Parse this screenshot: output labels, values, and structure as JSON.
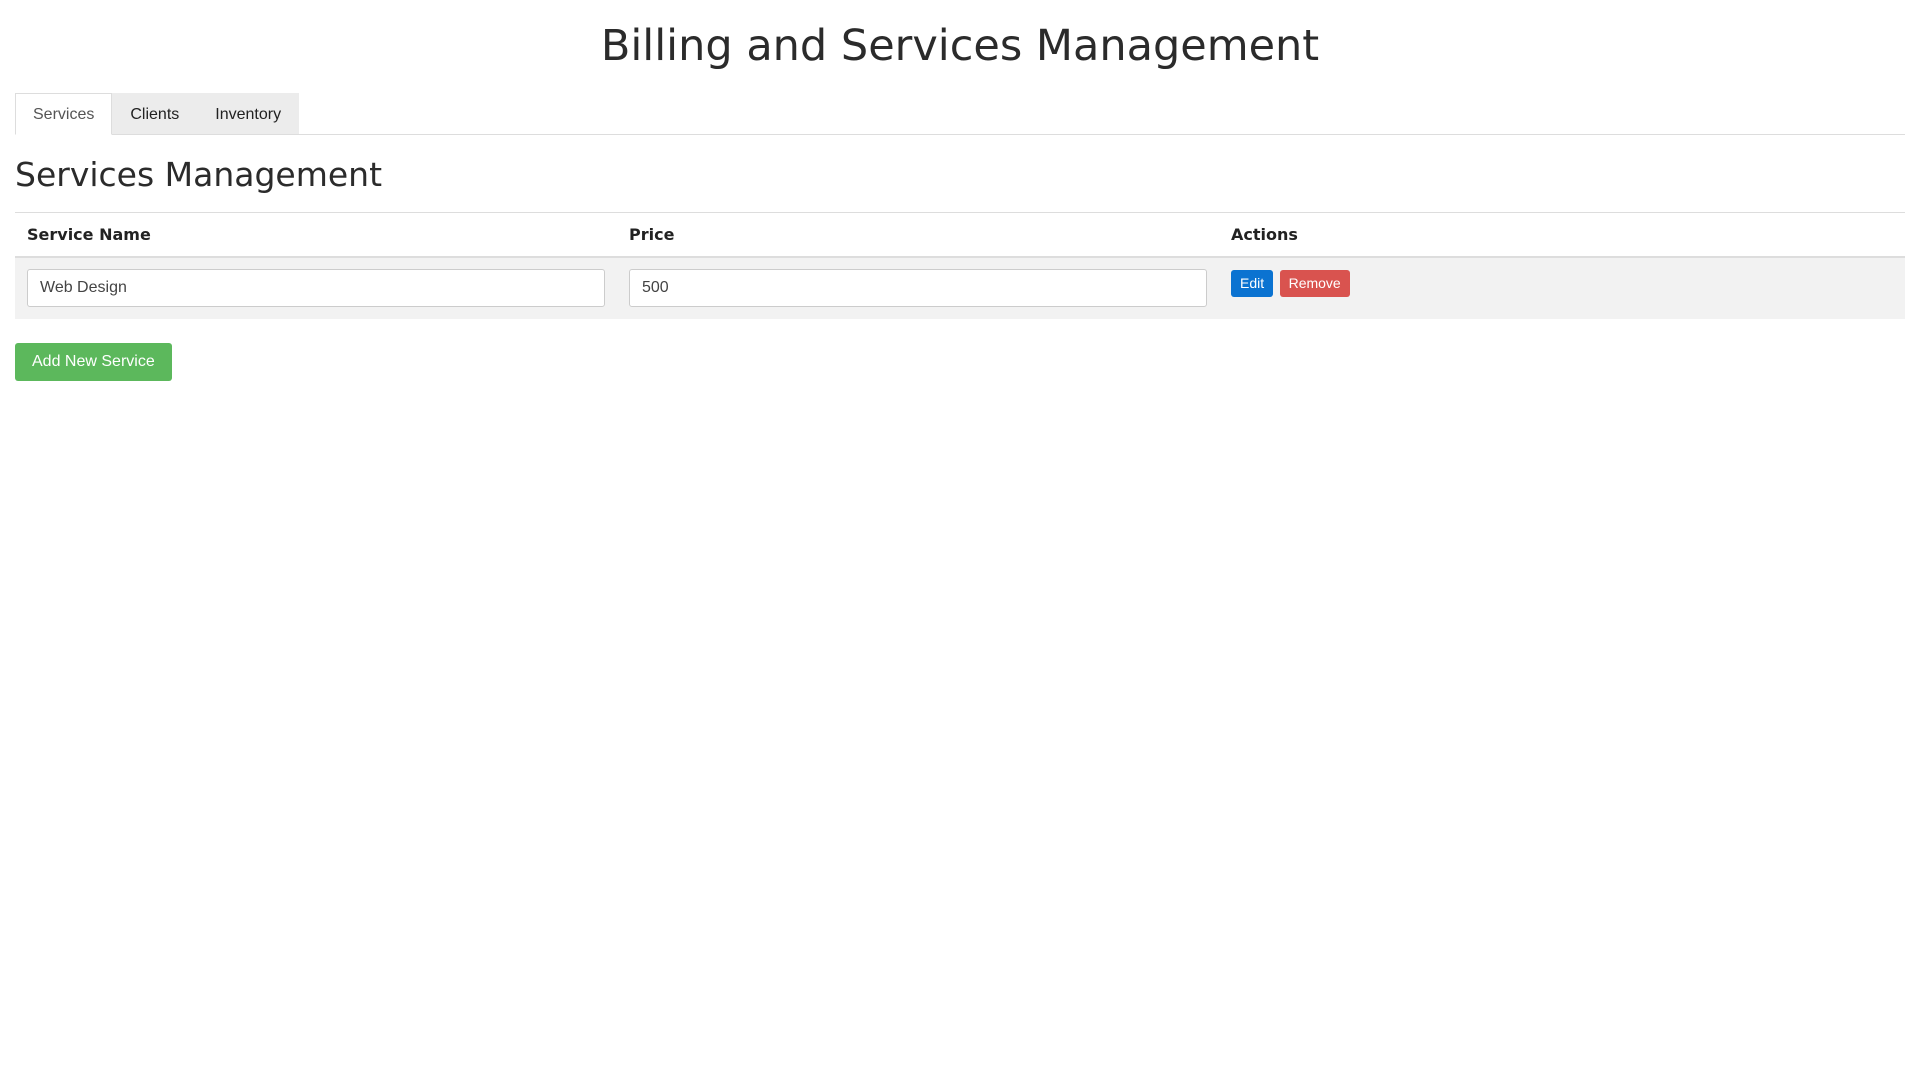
{
  "page": {
    "title": "Billing and Services Management"
  },
  "tabs": [
    {
      "label": "Services",
      "active": true
    },
    {
      "label": "Clients",
      "active": false
    },
    {
      "label": "Inventory",
      "active": false
    }
  ],
  "section": {
    "title": "Services Management"
  },
  "table": {
    "columns": [
      "Service Name",
      "Price",
      "Actions"
    ],
    "rows": [
      {
        "service_name": "Web Design",
        "price": "500",
        "edit_label": "Edit",
        "remove_label": "Remove"
      }
    ]
  },
  "add_button_label": "Add New Service",
  "colors": {
    "edit": "#0b73d1",
    "remove": "#d9534f",
    "add": "#5cb85c"
  }
}
